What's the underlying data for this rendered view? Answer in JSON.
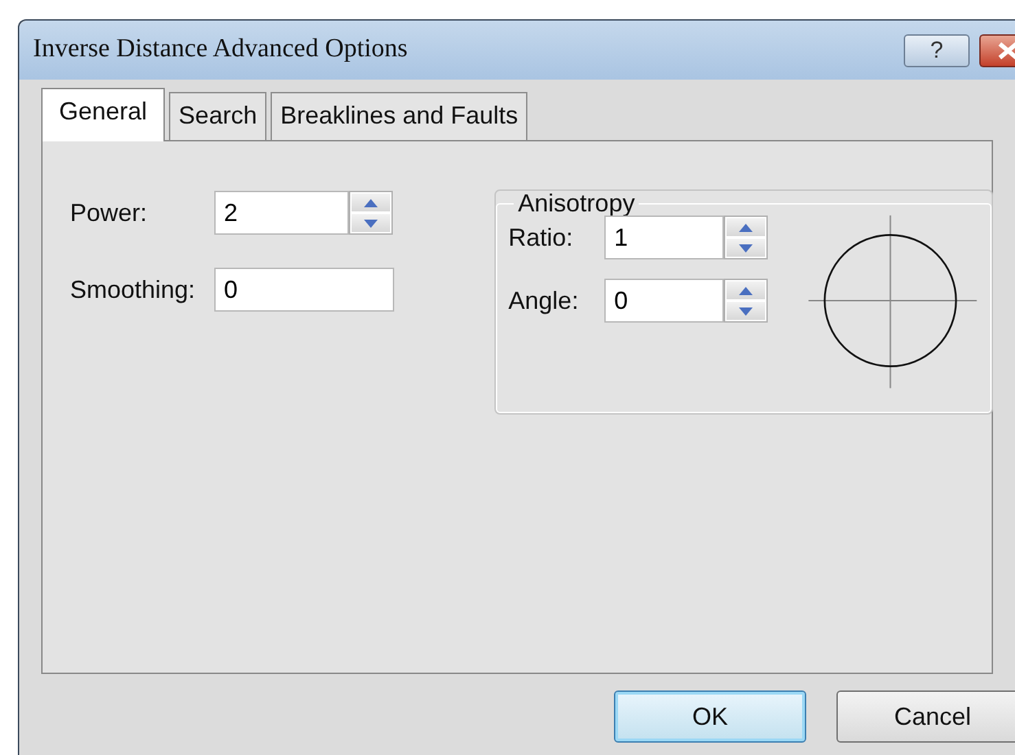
{
  "window": {
    "title": "Inverse Distance Advanced Options",
    "help_button": "?"
  },
  "tabs": [
    {
      "label": "General",
      "selected": true
    },
    {
      "label": "Search",
      "selected": false
    },
    {
      "label": "Breaklines and Faults",
      "selected": false
    }
  ],
  "fields": [
    {
      "label": "Power:",
      "value": "2",
      "kind": "spin"
    },
    {
      "label": "Smoothing:",
      "value": "0",
      "kind": "text"
    }
  ],
  "anisotropy": {
    "title": "Anisotropy",
    "fields": [
      {
        "label": "Ratio:",
        "value": "1",
        "kind": "spin"
      },
      {
        "label": "Angle:",
        "value": "0",
        "kind": "spin"
      }
    ]
  },
  "buttons": [
    {
      "label": "OK",
      "default": true
    },
    {
      "label": "Cancel",
      "default": false
    }
  ]
}
